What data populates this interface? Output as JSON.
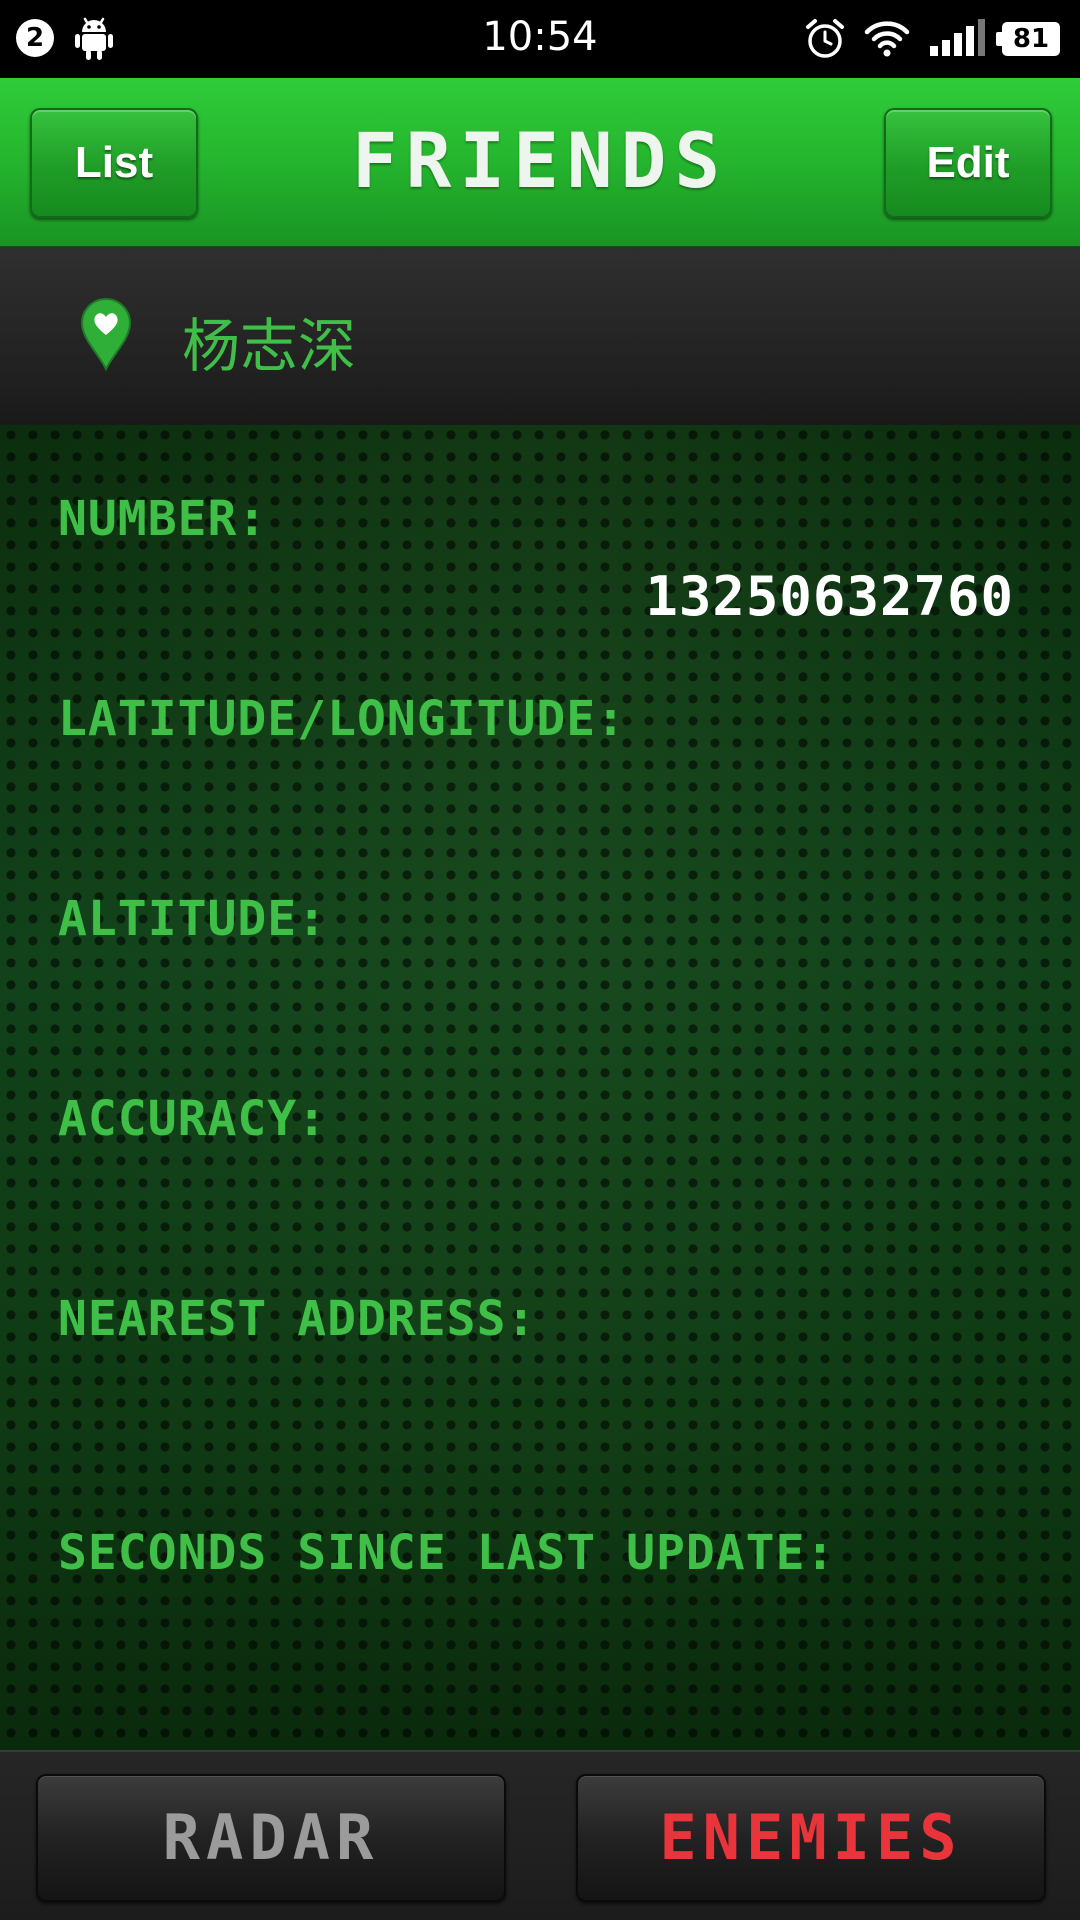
{
  "status_bar": {
    "notification_count": "2",
    "time": "10:54",
    "battery": "81",
    "icons": [
      "android-icon",
      "alarm-icon",
      "wifi-icon",
      "signal-icon",
      "battery-icon"
    ]
  },
  "header": {
    "left_button": "List",
    "title": "FRIENDS",
    "right_button": "Edit"
  },
  "contact": {
    "icon": "heart-pin-icon",
    "name": "杨志深"
  },
  "details": {
    "number_label": "NUMBER:",
    "number_value": "13250632760",
    "latlong_label": "LATITUDE/LONGITUDE:",
    "altitude_label": "ALTITUDE:",
    "accuracy_label": "ACCURACY:",
    "address_label": "NEAREST ADDRESS:",
    "seconds_label": "SECONDS SINCE LAST UPDATE:"
  },
  "bottom_nav": {
    "radar": "RADAR",
    "enemies": "ENEMIES"
  },
  "colors": {
    "accent_green": "#3fbf47",
    "header_green": "#26b82f",
    "enemies_red": "#e8343a",
    "radar_gray": "#9b9b9b"
  }
}
